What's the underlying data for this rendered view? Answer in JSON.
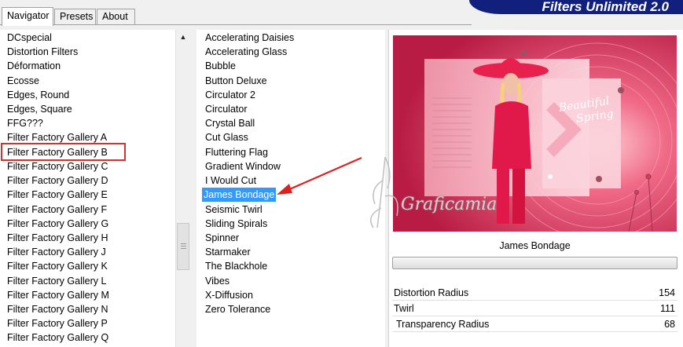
{
  "tabs": [
    {
      "label": "Navigator",
      "active": true
    },
    {
      "label": "Presets",
      "active": false
    },
    {
      "label": "About",
      "active": false
    }
  ],
  "banner": {
    "title": "Filters Unlimited 2.0"
  },
  "categories": [
    "DCspecial",
    "Distortion Filters",
    "Déformation",
    "Ecosse",
    "Edges, Round",
    "Edges, Square",
    "FFG???",
    "Filter Factory Gallery A",
    "Filter Factory Gallery B",
    "Filter Factory Gallery C",
    "Filter Factory Gallery D",
    "Filter Factory Gallery E",
    "Filter Factory Gallery F",
    "Filter Factory Gallery G",
    "Filter Factory Gallery H",
    "Filter Factory Gallery J",
    "Filter Factory Gallery K",
    "Filter Factory Gallery L",
    "Filter Factory Gallery M",
    "Filter Factory Gallery N",
    "Filter Factory Gallery P",
    "Filter Factory Gallery Q"
  ],
  "highlighted_category": "Filter Factory Gallery B",
  "filters": [
    "Accelerating Daisies",
    "Accelerating Glass",
    "Bubble",
    "Button Deluxe",
    "Circulator 2",
    "Circulator",
    "Crystal Ball",
    "Cut Glass",
    "Fluttering Flag",
    "Gradient Window",
    "I Would Cut",
    "James Bondage",
    "Seismic Twirl",
    "Sliding Spirals",
    "Spinner",
    "Starmaker",
    "The Blackhole",
    "Vibes",
    "X-Diffusion",
    "Zero Tolerance"
  ],
  "selected_filter": "James Bondage",
  "preview": {
    "filter_name": "James Bondage",
    "caption_line1": "Beautiful",
    "caption_line2": "Spring",
    "watermark": "Graficamia"
  },
  "parameters": [
    {
      "label": "Distortion Radius",
      "value": "154"
    },
    {
      "label": "Twirl",
      "value": "111"
    },
    {
      "label": "Transparency Radius",
      "value": "68"
    }
  ],
  "colors": {
    "banner": "#10207c",
    "selection": "#3399ff",
    "highlight_box": "#d43030",
    "arrow": "#e02020",
    "preview_pink": "#d63a5e"
  }
}
